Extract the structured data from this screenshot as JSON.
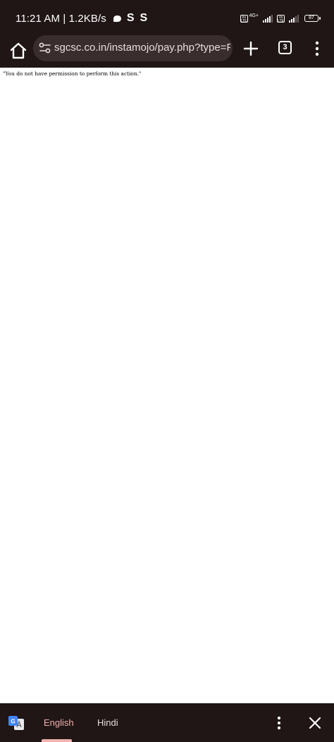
{
  "status_bar": {
    "time": "11:21 AM",
    "speed": "1.2KB/s",
    "app_glyph_1": "S",
    "app_glyph_2": "S",
    "network_type": "4G+",
    "volte_label": "Vo LTE",
    "battery_percent": "87"
  },
  "toolbar": {
    "url": "sgcsc.co.in/instamojo/pay.php?type=Franch",
    "tab_count": "3"
  },
  "page": {
    "message": "\"You do not have permission to perform this action.\""
  },
  "translate_bar": {
    "source_language": "English",
    "target_language": "Hindi",
    "icon": "google-translate-icon"
  },
  "colors": {
    "chrome_bg": "#201616",
    "url_bar_bg": "#3a2d2d",
    "accent": "#f2b2ad"
  }
}
